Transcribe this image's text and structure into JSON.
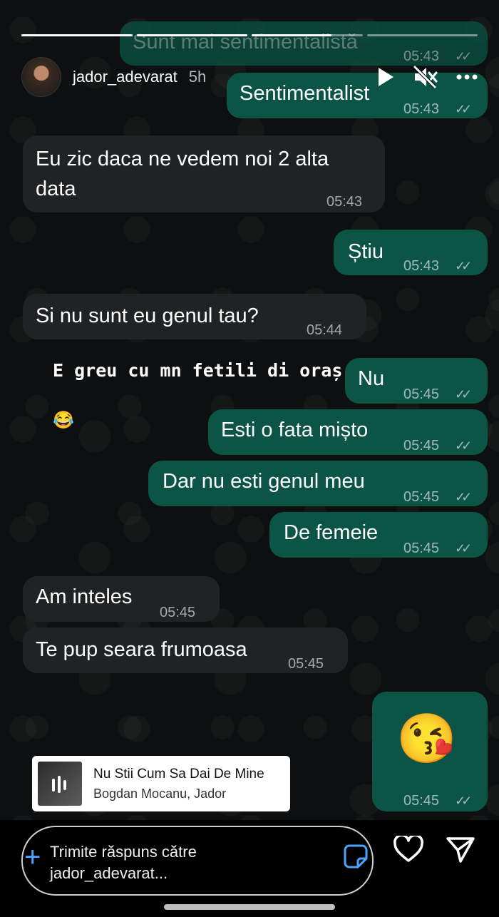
{
  "story": {
    "username": "jador_adevarat",
    "age": "5h",
    "progress": [
      1.0,
      1.0,
      0.72,
      0.0
    ]
  },
  "messages": [
    {
      "side": "out",
      "text": "Sunt mai sentimentalistă",
      "time": "05:43"
    },
    {
      "side": "out",
      "text": "Sentimentalist",
      "time": "05:43"
    },
    {
      "side": "in",
      "text": "Eu zic daca ne vedem noi 2 alta data",
      "time": "05:43"
    },
    {
      "side": "out",
      "text": "Știu",
      "time": "05:43"
    },
    {
      "side": "in",
      "text": "Si nu sunt eu genul tau?",
      "time": "05:44"
    },
    {
      "side": "out",
      "text": "Nu",
      "time": "05:45"
    },
    {
      "side": "out",
      "text": "Esti o fata mișto",
      "time": "05:45"
    },
    {
      "side": "out",
      "text": "Dar nu esti genul meu",
      "time": "05:45"
    },
    {
      "side": "out",
      "text": "De femeie",
      "time": "05:45"
    },
    {
      "side": "in",
      "text": "Am inteles",
      "time": "05:45"
    },
    {
      "side": "in",
      "text": "Te pup seara frumoasa",
      "time": "05:45"
    },
    {
      "side": "out",
      "text": "😘",
      "time": "05:45"
    }
  ],
  "caption": {
    "text": "E greu cu mn fetili di oraș",
    "emoji": "😂"
  },
  "music": {
    "title": "Nu Stii Cum Sa Dai De Mine",
    "artist": "Bogdan Mocanu, Jador"
  },
  "reply": {
    "placeholder": "Trimite răspuns către jador_adevarat..."
  },
  "icons": {
    "play": "play-icon",
    "mute": "speaker-muted-icon",
    "more": "more-horizontal-icon",
    "heart": "heart-icon",
    "send": "send-icon",
    "sticker": "sticker-icon",
    "plus": "plus-icon"
  },
  "colors": {
    "incoming": "#202224",
    "outgoing": "#0b5446"
  }
}
